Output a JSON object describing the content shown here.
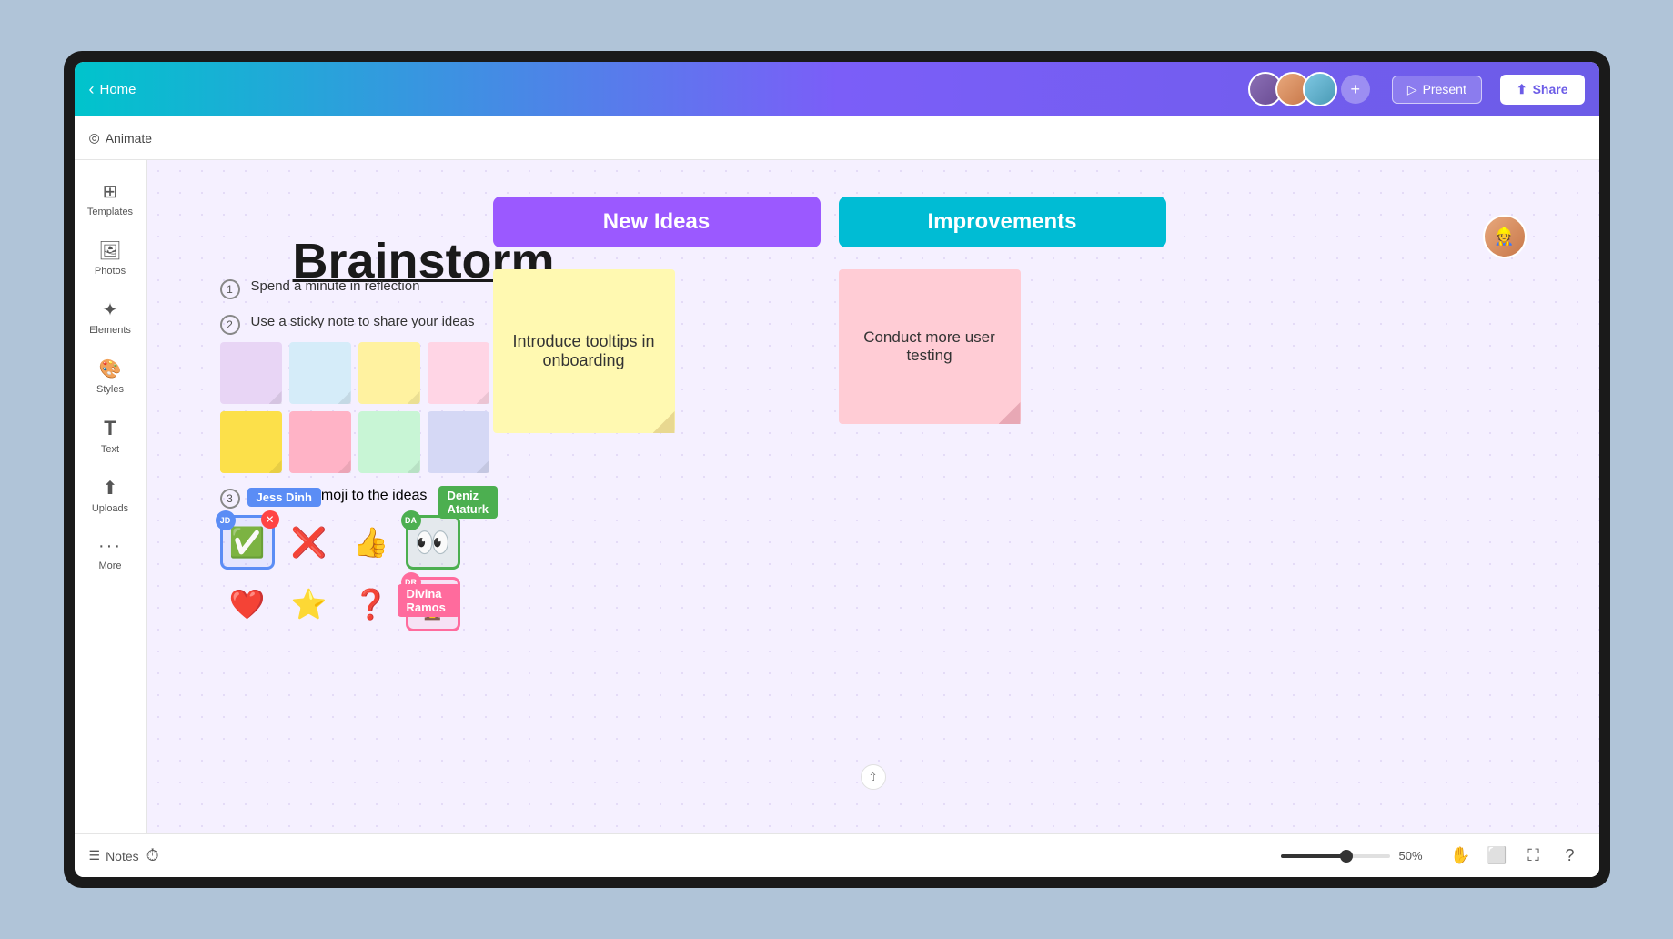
{
  "header": {
    "home_label": "Home",
    "present_label": "Present",
    "share_label": "Share",
    "avatars": [
      {
        "id": "avatar-1",
        "initials": ""
      },
      {
        "id": "avatar-2",
        "initials": ""
      },
      {
        "id": "avatar-3",
        "initials": ""
      }
    ]
  },
  "toolbar": {
    "animate_label": "Animate"
  },
  "sidebar": {
    "items": [
      {
        "id": "templates",
        "label": "Templates",
        "icon": "⊞"
      },
      {
        "id": "photos",
        "label": "Photos",
        "icon": "🖼"
      },
      {
        "id": "elements",
        "label": "Elements",
        "icon": "✦"
      },
      {
        "id": "styles",
        "label": "Styles",
        "icon": "🎨"
      },
      {
        "id": "text",
        "label": "Text",
        "icon": "T"
      },
      {
        "id": "uploads",
        "label": "Uploads",
        "icon": "⬆"
      },
      {
        "id": "more",
        "label": "More",
        "icon": "···"
      }
    ]
  },
  "canvas": {
    "title": "Brainstorm",
    "columns": [
      {
        "id": "new-ideas",
        "label": "New Ideas",
        "color": "#9b59ff"
      },
      {
        "id": "improvements",
        "label": "Improvements",
        "color": "#00bcd4"
      }
    ],
    "instructions": [
      {
        "num": "1",
        "text": "Spend a minute in reflection"
      },
      {
        "num": "2",
        "text": "Use a sticky note to share your ideas"
      },
      {
        "num": "3",
        "text": "Add your emoji to the ideas"
      }
    ],
    "sticky_notes": [
      {
        "id": "sn-yellow-big",
        "text": "Introduce tooltips in onboarding",
        "color": "#fff9b1"
      },
      {
        "id": "sn-pink-big",
        "text": "Conduct more user testing",
        "color": "#ffccd5"
      }
    ],
    "emojis": [
      {
        "id": "em-check",
        "emoji": "✅",
        "selected": true,
        "user": "JD"
      },
      {
        "id": "em-x",
        "emoji": "❌",
        "selected": false
      },
      {
        "id": "em-thumbs",
        "emoji": "👍",
        "selected": false
      },
      {
        "id": "em-eyes",
        "emoji": "👀",
        "selected": true,
        "user": "DA"
      },
      {
        "id": "em-heart",
        "emoji": "❤️",
        "selected": false
      },
      {
        "id": "em-star",
        "emoji": "⭐",
        "selected": false
      },
      {
        "id": "em-question",
        "emoji": "❓",
        "selected": false
      },
      {
        "id": "em-trophy",
        "emoji": "🏆",
        "selected": true,
        "user": "DR"
      }
    ],
    "user_labels": [
      {
        "id": "jess-dinh",
        "name": "Jess Dinh",
        "color": "#5b8df5",
        "badge": "JD"
      },
      {
        "id": "deniz-ataturk",
        "name": "Deniz Ataturk",
        "color": "#4caf50",
        "badge": "DA"
      },
      {
        "id": "divina-ramos",
        "name": "Divina Ramos",
        "color": "#ff6b9d",
        "badge": "DR"
      }
    ]
  },
  "bottom_bar": {
    "notes_label": "Notes",
    "zoom_percent": "50%"
  }
}
